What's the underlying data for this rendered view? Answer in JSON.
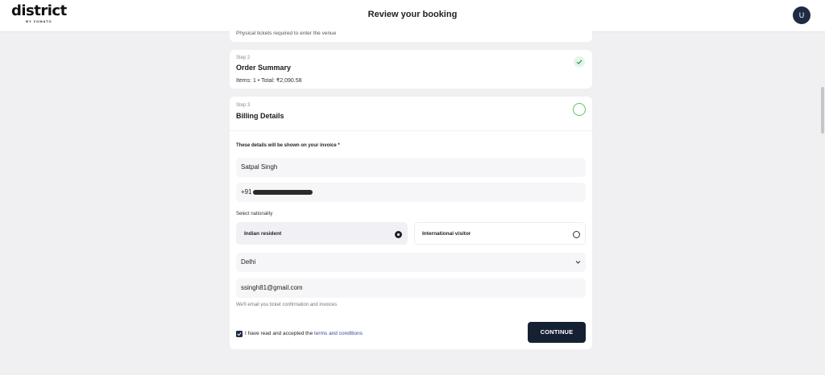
{
  "header": {
    "logo": "district",
    "logo_sub": "BY ZOMATO",
    "title": "Review your booking",
    "avatar_initial": "U"
  },
  "step1": {
    "note": "Physical tickets required to enter the venue"
  },
  "step2": {
    "label": "Step 2",
    "title": "Order Summary",
    "summary": "Items: 1 • Total: ₹2,090.58",
    "status": "completed"
  },
  "step3": {
    "label": "Step 3",
    "title": "Billing Details",
    "invoice_label": "These details will be shown on your invoice *",
    "name_value": "Satpal Singh",
    "phone_prefix": "+91",
    "nationality_label": "Select nationality",
    "options": [
      {
        "label": "Indian resident",
        "selected": true
      },
      {
        "label": "International visitor",
        "selected": false
      }
    ],
    "state_value": "Delhi",
    "email_value": "ssingh81@gmail.com",
    "email_hint": "We'll email you ticket confirmation and invoices",
    "terms_prefix": "I have read and accepted the ",
    "terms_link": "terms and conditions",
    "terms_checked": true,
    "continue_label": "CONTINUE"
  },
  "icons": {
    "step2_status": "check-icon",
    "step3_status": "pending-circle-icon",
    "state_dropdown": "chevron-down-icon",
    "terms_checkbox": "checkbox-checked-icon"
  },
  "colors": {
    "background": "#f0f0f3",
    "primary_button": "#152033",
    "avatar": "#1d2b44",
    "success": "#5cc36a",
    "link": "#3a4a9a"
  }
}
